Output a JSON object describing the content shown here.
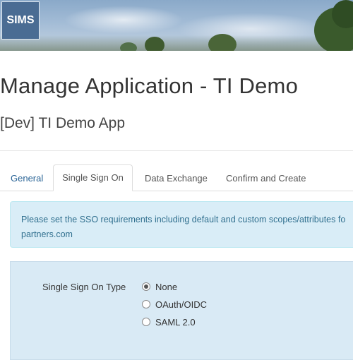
{
  "header": {
    "logo_text": "SIMS"
  },
  "page": {
    "title": "Manage Application - TI Demo",
    "subtitle": "[Dev] TI Demo App"
  },
  "tabs": [
    {
      "label": "General",
      "active": false
    },
    {
      "label": "Single Sign On",
      "active": true
    },
    {
      "label": "Data Exchange",
      "active": false
    },
    {
      "label": "Confirm and Create",
      "active": false
    }
  ],
  "alert": {
    "line1": "Please set the SSO requirements including default and custom scopes/attributes fo",
    "line2": "partners.com"
  },
  "sso_form": {
    "type_label": "Single Sign On Type",
    "options": [
      {
        "label": "None",
        "selected": true
      },
      {
        "label": "OAuth/OIDC",
        "selected": false
      },
      {
        "label": "SAML 2.0",
        "selected": false
      }
    ]
  },
  "colors": {
    "link": "#2a6496",
    "alert_bg": "#d9edf7",
    "alert_text": "#31708f",
    "panel_bg": "#d9eaf5",
    "logo_bg": "#4a6c93"
  }
}
